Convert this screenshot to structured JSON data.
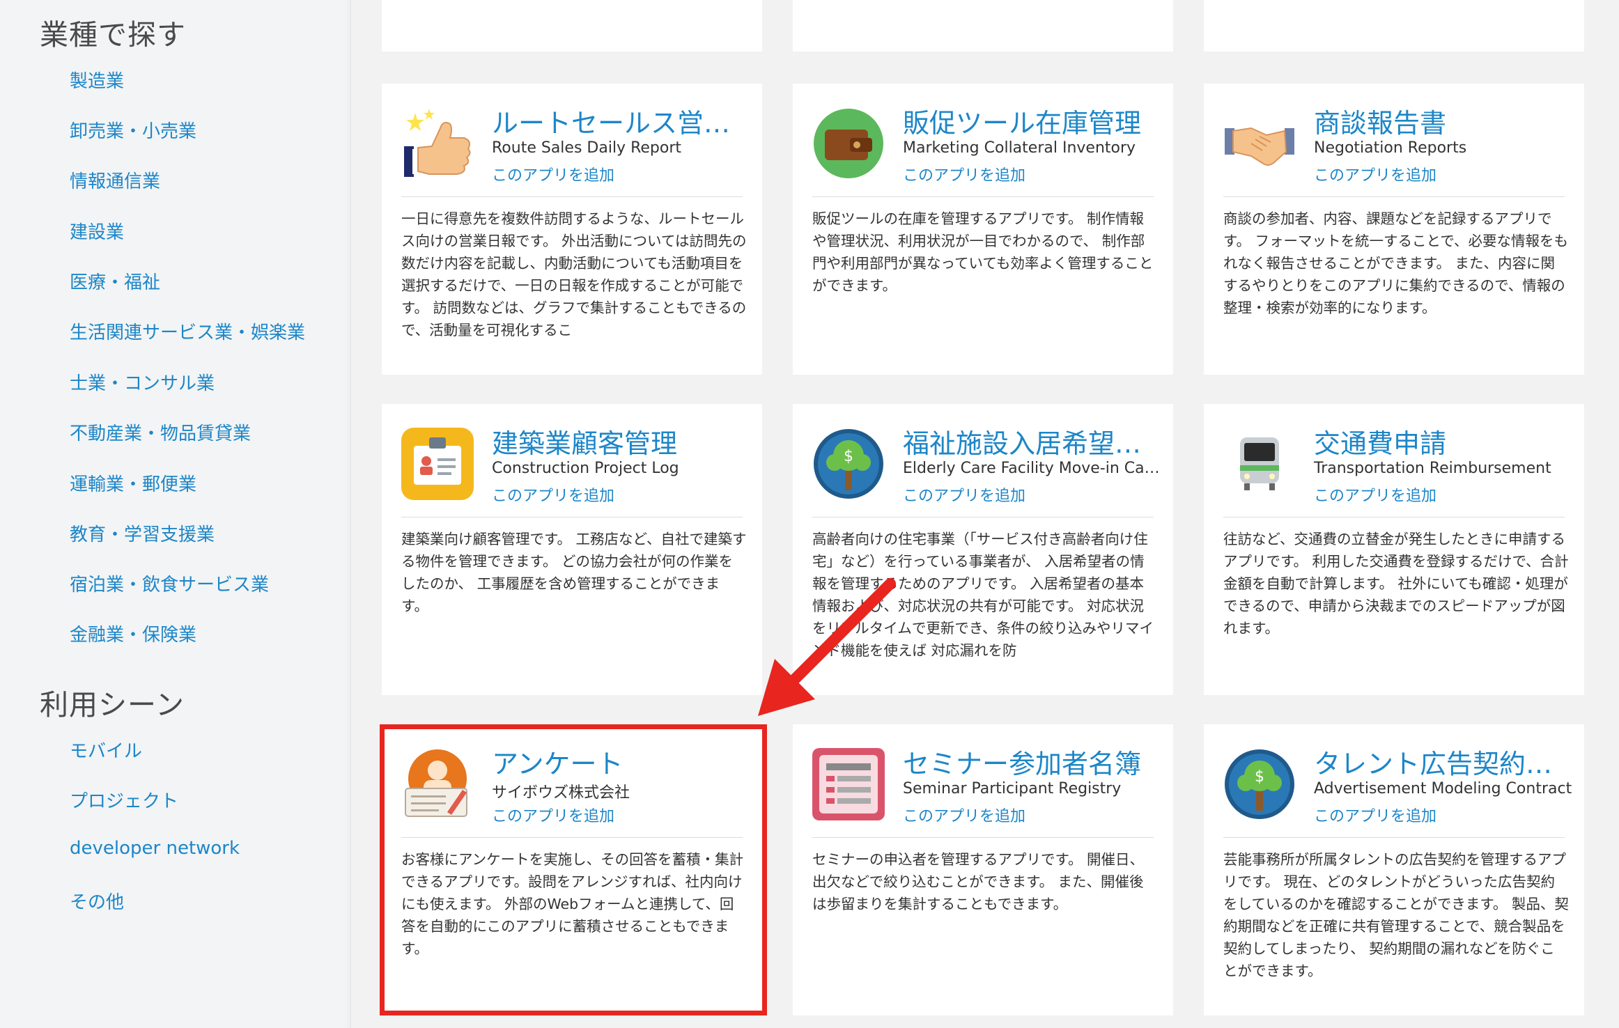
{
  "sidebar": {
    "industry_heading": "業種で探す",
    "industries": [
      "製造業",
      "卸売業・小売業",
      "情報通信業",
      "建設業",
      "医療・福祉",
      "生活関連サービス業・娯楽業",
      "士業・コンサル業",
      "不動産業・物品賃貸業",
      "運輸業・郵便業",
      "教育・学習支援業",
      "宿泊業・飲食サービス業",
      "金融業・保険業"
    ],
    "scene_heading": "利用シーン",
    "scenes": [
      "モバイル",
      "プロジェクト",
      "developer network",
      "その他"
    ]
  },
  "add_label": "このアプリを追加",
  "cards": [
    {
      "title": "ルートセールス営業…",
      "subtitle": "Route Sales Daily Report",
      "desc": "一日に得意先を複数件訪問するような、ルートセールス向けの営業日報です。 外出活動については訪問先の数だけ内容を記載し、内動活動についても活動項目を 選択するだけで、一日の日報を作成することが可能です。 訪問数などは、グラフで集計することもできるので、活動量を可視化するこ",
      "icon": "thumbs-up-icon"
    },
    {
      "title": "販促ツール在庫管理",
      "subtitle": "Marketing Collateral Inventory",
      "desc": "販促ツールの在庫を管理するアプリです。 制作情報や管理状況、利用状況が一目でわかるので、 制作部門や利用部門が異なっていても効率よく管理することができます。",
      "icon": "wallet-icon"
    },
    {
      "title": "商談報告書",
      "subtitle": "Negotiation Reports",
      "desc": "商談の参加者、内容、課題などを記録するアプリです。 フォーマットを統一することで、必要な情報をもれなく報告させることができます。 また、内容に関するやりとりをこのアプリに集約できるので、情報の整理・検索が効率的になります。",
      "icon": "handshake-icon"
    },
    {
      "title": "建築業顧客管理",
      "subtitle": "Construction Project Log",
      "desc": "建築業向け顧客管理です。 工務店など、自社で建築する物件を管理できます。 どの協力会社が何の作業をしたのか、 工事履歴を含め管理することができます。",
      "icon": "id-badge-icon"
    },
    {
      "title": "福祉施設入居希望者…",
      "subtitle": "Elderly Care Facility Move-in Ca…",
      "desc": "高齢者向けの住宅事業（「サービス付き高齢者向け住宅」など）を行っている事業者が、 入居希望者の情報を管理するためのアプリです。 入居希望者の基本情報および、対応状況の共有が可能です。 対応状況をリアルタイムで更新でき、条件の絞り込みやリマインド機能を使えば 対応漏れを防",
      "icon": "money-tree-icon"
    },
    {
      "title": "交通費申請",
      "subtitle": "Transportation Reimbursement",
      "desc": "往訪など、交通費の立替金が発生したときに申請するアプリです。 利用した交通費を登録するだけで、合計金額を自動で計算します。 社外にいても確認・処理ができるので、申請から決裁までのスピードアップが図れます。",
      "icon": "train-icon"
    },
    {
      "title": "アンケート",
      "subtitle": "サイボウズ株式会社",
      "desc": "お客様にアンケートを実施し、その回答を蓄積・集計できるアプリです。設問をアレンジすれば、社内向けにも使えます。 外部のWebフォームと連携して、回答を自動的にこのアプリに蓄積させることもできます。",
      "icon": "survey-icon"
    },
    {
      "title": "セミナー参加者名簿",
      "subtitle": "Seminar Participant Registry",
      "desc": "セミナーの申込者を管理するアプリです。 開催日、出欠などで絞り込むことができます。 また、開催後は歩留まりを集計することもできます。",
      "icon": "registry-icon"
    },
    {
      "title": "タレント広告契約管理",
      "subtitle": "Advertisement Modeling Contract",
      "desc": "芸能事務所が所属タレントの広告契約を管理するアプリです。 現在、どのタレントがどういった広告契約をしているのかを確認することができます。 製品、契約期間などを正確に共有管理することで、競合製品を契約してしまったり、 契約期間の漏れなどを防ぐことができます。",
      "icon": "money-tree-icon"
    }
  ],
  "colors": {
    "link": "#1d86c8",
    "highlight": "#e8251f"
  }
}
